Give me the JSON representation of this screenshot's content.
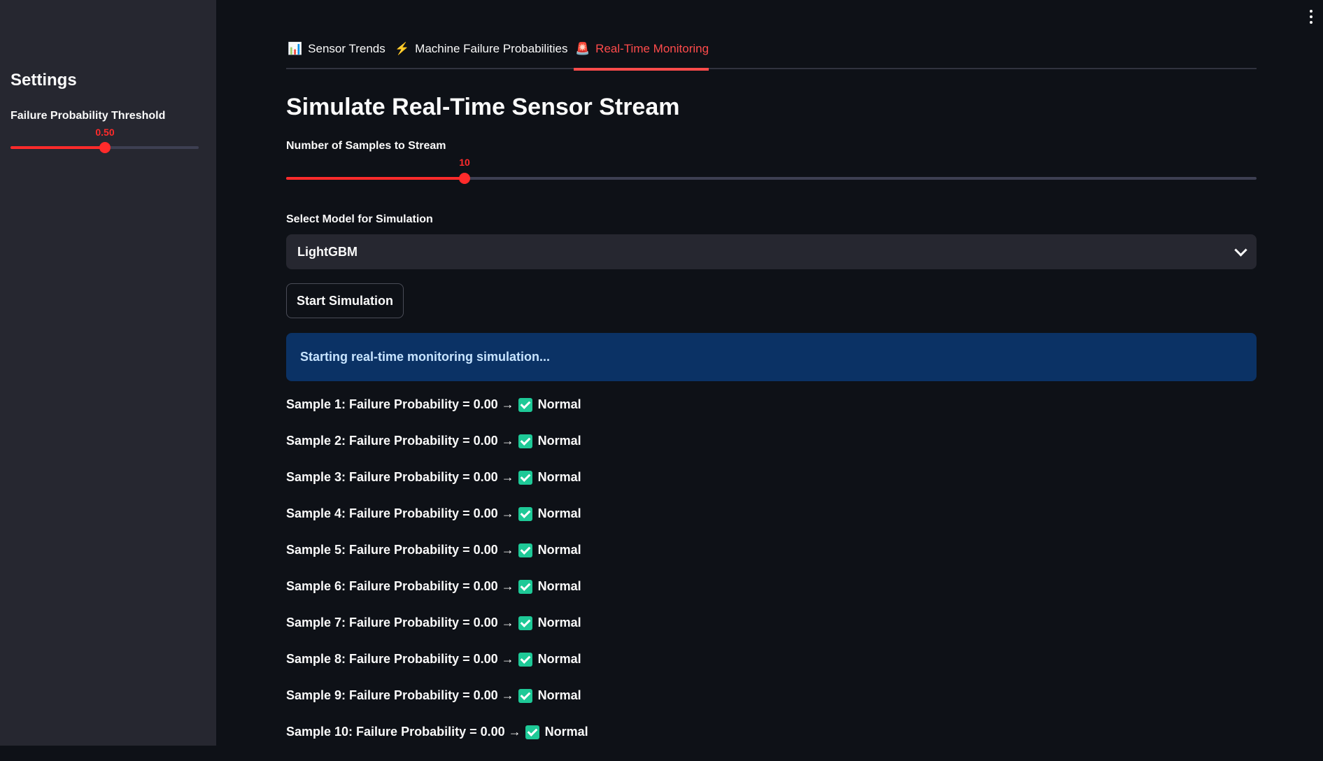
{
  "sidebar": {
    "title": "Settings",
    "threshold_label": "Failure Probability Threshold",
    "threshold_value": "0.50",
    "threshold_fraction": 0.5
  },
  "tabs": [
    {
      "icon": "📊",
      "icon_name": "bar-chart-icon",
      "label": "Sensor Trends",
      "active": false
    },
    {
      "icon": "⚡",
      "icon_name": "lightning-icon",
      "label": "Machine Failure Probabilities",
      "active": false
    },
    {
      "icon": "🚨",
      "icon_name": "siren-icon",
      "label": "Real-Time Monitoring",
      "active": true
    }
  ],
  "main": {
    "heading": "Simulate Real-Time Sensor Stream",
    "samples_label": "Number of Samples to Stream",
    "samples_value": "10",
    "samples_fraction": 0.184,
    "model_label": "Select Model for Simulation",
    "model_selected": "LightGBM",
    "start_button": "Start Simulation",
    "info_message": "Starting real-time monitoring simulation..."
  },
  "samples": [
    {
      "text": "Sample 1: Failure Probability = 0.00",
      "arrow": "→",
      "status": "Normal"
    },
    {
      "text": "Sample 2: Failure Probability = 0.00",
      "arrow": "→",
      "status": "Normal"
    },
    {
      "text": "Sample 3: Failure Probability = 0.00",
      "arrow": "→",
      "status": "Normal"
    },
    {
      "text": "Sample 4: Failure Probability = 0.00",
      "arrow": "→",
      "status": "Normal"
    },
    {
      "text": "Sample 5: Failure Probability = 0.00",
      "arrow": "→",
      "status": "Normal"
    },
    {
      "text": "Sample 6: Failure Probability = 0.00",
      "arrow": "→",
      "status": "Normal"
    },
    {
      "text": "Sample 7: Failure Probability = 0.00",
      "arrow": "→",
      "status": "Normal"
    },
    {
      "text": "Sample 8: Failure Probability = 0.00",
      "arrow": "→",
      "status": "Normal"
    },
    {
      "text": "Sample 9: Failure Probability = 0.00",
      "arrow": "→",
      "status": "Normal"
    },
    {
      "text": "Sample 10: Failure Probability = 0.00",
      "arrow": "→",
      "status": "Normal"
    }
  ],
  "colors": {
    "accent": "#ff4b4b",
    "background": "#0e1117",
    "sidebar": "#262730",
    "info_bg": "#0b3265",
    "check": "#1ec997"
  }
}
